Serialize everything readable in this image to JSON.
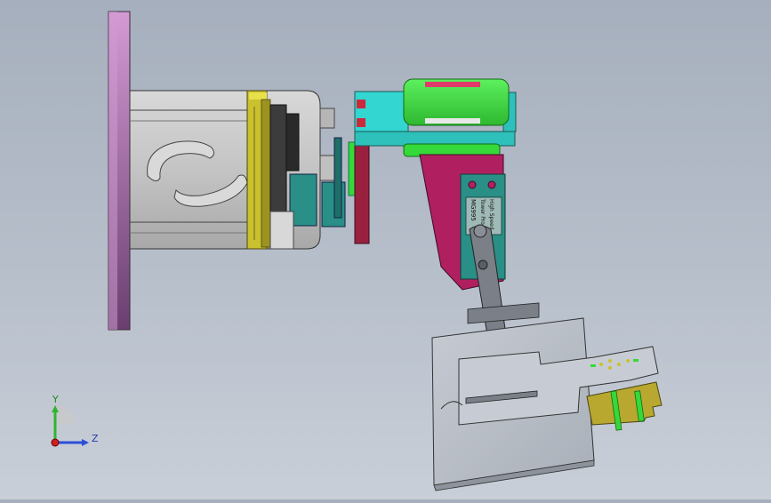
{
  "viewport": {
    "background_colors": [
      "#a6afbd",
      "#c9cfd8"
    ]
  },
  "model": {
    "parts": {
      "mounting_plate": "#b07ab0",
      "motor_housing": "#c8c8c8",
      "motor_flange": "#c9c12e",
      "coupling": "#5a5a5a",
      "bracket_cyan": "#33d6d0",
      "bracket_green": "#35d93a",
      "bracket_dark_red": "#9a2040",
      "servo_mount": "#b02060",
      "servo_body": "#2a8f86",
      "servo_arm": "#7b8088",
      "gripper_base": "#b9bec6",
      "gripper_jaw_yellow": "#b8a830"
    },
    "servo_label_lines": [
      "MG995",
      "Tower Pro",
      "High Speed"
    ]
  },
  "triad": {
    "y_label": "Y",
    "z_label": "Z",
    "y_color": "#2fb52f",
    "z_color": "#2b4fd8",
    "x_color": "#d02020"
  }
}
